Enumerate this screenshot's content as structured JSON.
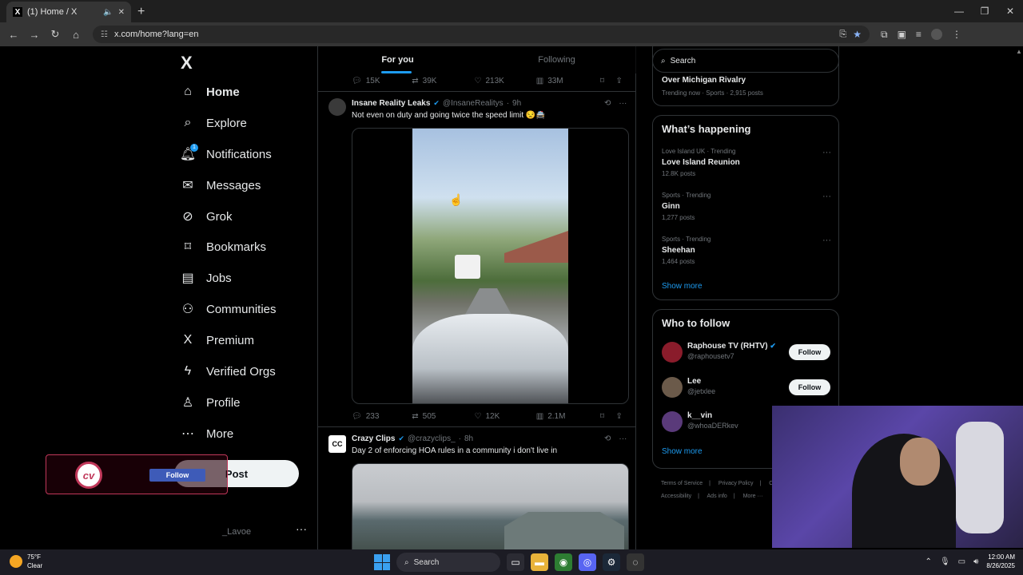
{
  "browser": {
    "tab_title": "(1) Home / X",
    "url": "x.com/home?lang=en",
    "new_tab": "+"
  },
  "sidebar": {
    "logo": "X",
    "items": [
      {
        "label": "Home",
        "icon": "home-icon"
      },
      {
        "label": "Explore",
        "icon": "search-icon"
      },
      {
        "label": "Notifications",
        "icon": "bell-icon",
        "badge": "1"
      },
      {
        "label": "Messages",
        "icon": "mail-icon"
      },
      {
        "label": "Grok",
        "icon": "grok-icon"
      },
      {
        "label": "Bookmarks",
        "icon": "bookmark-icon"
      },
      {
        "label": "Jobs",
        "icon": "briefcase-icon"
      },
      {
        "label": "Communities",
        "icon": "people-icon"
      },
      {
        "label": "Premium",
        "icon": "x-icon"
      },
      {
        "label": "Verified Orgs",
        "icon": "lightning-icon"
      },
      {
        "label": "Profile",
        "icon": "person-icon"
      },
      {
        "label": "More",
        "icon": "more-circle-icon"
      }
    ],
    "post_label": "Post",
    "account_handle": "_Lavoe",
    "overlay_follow": "Follow",
    "overlay_logo": "cv"
  },
  "feed": {
    "tabs": [
      {
        "label": "For you",
        "active": true
      },
      {
        "label": "Following",
        "active": false
      }
    ],
    "prev_post_actions": {
      "replies": "15K",
      "reposts": "39K",
      "likes": "213K",
      "views": "33M"
    },
    "posts": [
      {
        "name": "Insane Reality Leaks",
        "handle": "@InsaneRealitys",
        "time": "9h",
        "text": "Not even on duty and going twice the speed limit 😒🚔",
        "actions": {
          "replies": "233",
          "reposts": "505",
          "likes": "12K",
          "views": "2.1M"
        }
      },
      {
        "name": "Crazy Clips",
        "handle": "@crazyclips_",
        "time": "8h",
        "text": "Day 2 of enforcing HOA rules in a community i don't live in",
        "avatar_text": "CC"
      }
    ]
  },
  "right": {
    "search_placeholder": "Search",
    "top_trend": {
      "name": "Over Michigan Rivalry",
      "meta": "Trending now · Sports · 2,915 posts"
    },
    "happening_title": "What’s happening",
    "trends": [
      {
        "meta": "Love Island UK · Trending",
        "name": "Love Island Reunion",
        "posts": "12.8K posts"
      },
      {
        "meta": "Sports · Trending",
        "name": "Ginn",
        "posts": "1,277 posts"
      },
      {
        "meta": "Sports · Trending",
        "name": "Sheehan",
        "posts": "1,464 posts"
      }
    ],
    "show_more": "Show more",
    "who_to_follow_title": "Who to follow",
    "who_to_follow": [
      {
        "name": "Raphouse TV (RHTV)",
        "handle": "@raphousetv7",
        "verified": true,
        "button": "Follow"
      },
      {
        "name": "Lee",
        "handle": "@jetxlee",
        "verified": false,
        "button": "Follow"
      },
      {
        "name": "k__vin",
        "handle": "@whoaDERkev",
        "verified": false,
        "button": ""
      }
    ],
    "footer_links": [
      "Terms of Service",
      "Privacy Policy",
      "C",
      "Accessibility",
      "Ads info",
      "More ···"
    ]
  },
  "taskbar": {
    "temp": "75°F",
    "condition": "Clear",
    "search": "Search",
    "time": "12:00 AM",
    "date": "8/26/2025"
  }
}
